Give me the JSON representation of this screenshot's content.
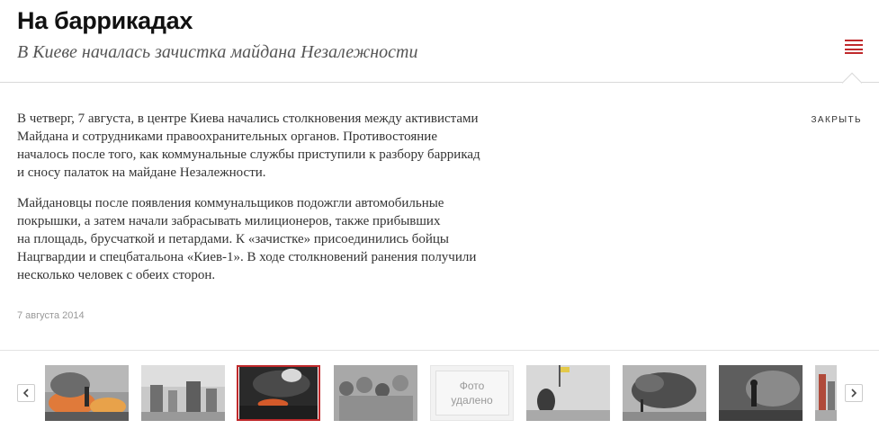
{
  "header": {
    "title": "На баррикадах",
    "subtitle": "В Киеве началась зачистка майдана Незалежности"
  },
  "controls": {
    "close_label": "ЗАКРЫТЬ",
    "menu_icon": "list-icon",
    "prev_icon": "chevron-left-icon",
    "next_icon": "chevron-right-icon",
    "accent_color": "#c0292b"
  },
  "article": {
    "paragraphs": [
      "В четверг, 7 августа, в центре Киева начались столкновения между активистами\nМайдана и сотрудниками правоохранительных органов. Противостояние\nначалось после того, как коммунальные службы приступили к разбору баррикад\nи сносу палаток на майдане Незалежности.",
      "Майдановцы после появления коммунальщиков подожгли автомобильные\nпокрышки, а затем начали забрасывать милиционеров, также прибывших\nна площадь, брусчаткой и петардами. К «зачистке» присоединились бойцы\nНацгвардии и спецбатальона «Киев-1». В ходе столкновений ранения получили\nнесколько человек с обеих сторон."
    ],
    "date": "7 августа 2014"
  },
  "gallery": {
    "removed_label": "Фото\nудалено",
    "active_index": 2
  }
}
